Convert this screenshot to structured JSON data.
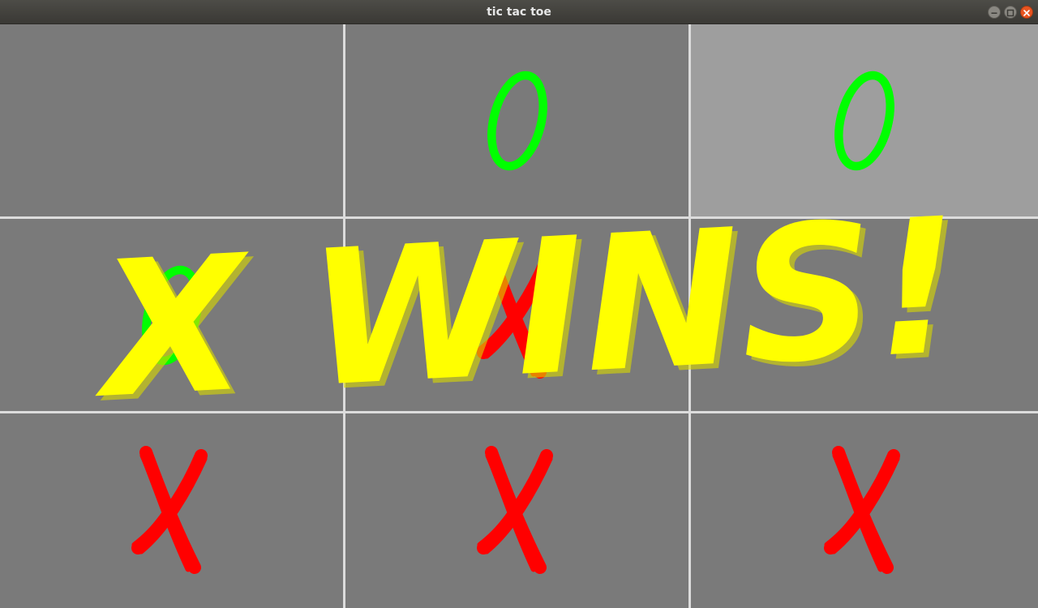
{
  "window": {
    "title": "tic tac toe"
  },
  "board": {
    "cells": [
      {
        "row": 0,
        "col": 0,
        "mark": "",
        "highlight": false
      },
      {
        "row": 0,
        "col": 1,
        "mark": "O",
        "highlight": false
      },
      {
        "row": 0,
        "col": 2,
        "mark": "O",
        "highlight": true
      },
      {
        "row": 1,
        "col": 0,
        "mark": "O",
        "highlight": false
      },
      {
        "row": 1,
        "col": 1,
        "mark": "X",
        "highlight": false
      },
      {
        "row": 1,
        "col": 2,
        "mark": "",
        "highlight": false
      },
      {
        "row": 2,
        "col": 0,
        "mark": "X",
        "highlight": false
      },
      {
        "row": 2,
        "col": 1,
        "mark": "X",
        "highlight": false
      },
      {
        "row": 2,
        "col": 2,
        "mark": "X",
        "highlight": false
      }
    ]
  },
  "result": {
    "message": "X WINS!"
  },
  "colors": {
    "x_mark": "#ff0000",
    "o_mark": "#00ff00",
    "banner": "#ffff00",
    "cell": "#7a7a7a",
    "cell_highlight": "#9e9e9e",
    "grid_line": "#dcdcdc"
  }
}
